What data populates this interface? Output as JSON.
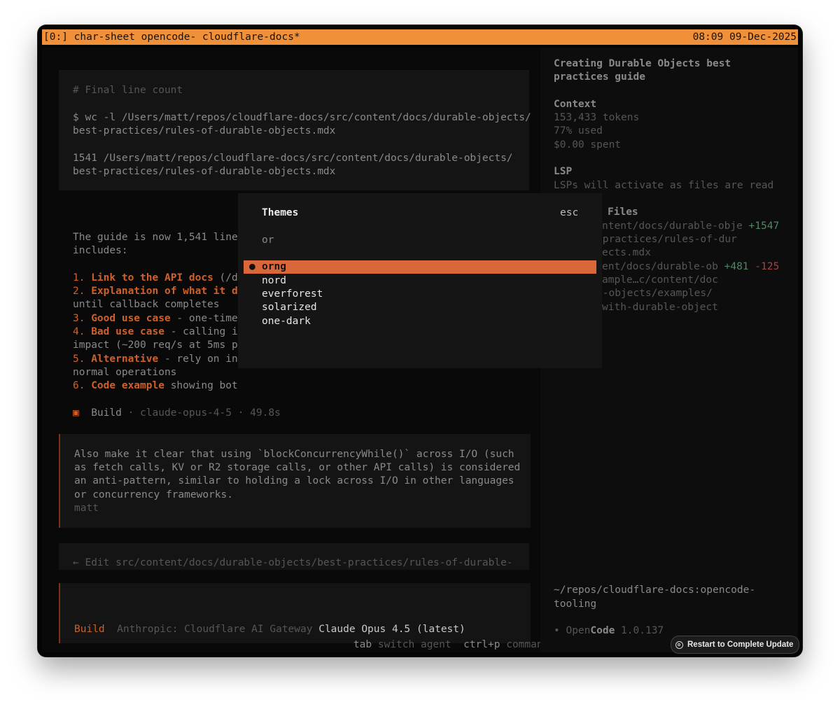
{
  "statusbar": {
    "left": "[0:] char-sheet opencode- cloudflare-docs*",
    "right": "08:09 09-Dec-2025"
  },
  "main": {
    "tool_block": {
      "comment": "# Final line count",
      "cmd1": "$ wc -l /Users/matt/repos/cloudflare-docs/src/content/docs/durable-objects/",
      "cmd2": "best-practices/rules-of-durable-objects.mdx",
      "out1": "1541 /Users/matt/repos/cloudflare-docs/src/content/docs/durable-objects/",
      "out2": "best-practices/rules-of-durable-objects.mdx"
    },
    "summary": {
      "line1": "The guide is now 1,541 line",
      "line2": "includes:",
      "items": [
        {
          "num": "1.",
          "bold": "Link to the API docs",
          "rest": " (/d"
        },
        {
          "num": "2.",
          "bold": "Explanation of what it d",
          "rest": ""
        },
        {
          "num": "",
          "bold": "",
          "rest": "until callback completes"
        },
        {
          "num": "3.",
          "bold": "Good use case",
          "rest": " - one-time"
        },
        {
          "num": "4.",
          "bold": "Bad use case",
          "rest": " - calling i"
        },
        {
          "num": "",
          "bold": "",
          "rest": "impact (~200 req/s at 5ms p"
        },
        {
          "num": "5.",
          "bold": "Alternative",
          "rest": " - rely on in"
        },
        {
          "num": "",
          "bold": "",
          "rest": "normal operations"
        },
        {
          "num": "6.",
          "bold": "Code example",
          "rest": " showing bot"
        }
      ],
      "build_icon": "▣",
      "build_label": "Build",
      "build_meta": " · claude-opus-4-5 · 49.8s"
    },
    "user_message": {
      "lines": [
        "Also make it clear that using `blockConcurrencyWhile()` across I/O (such",
        "as fetch calls, KV or R2 storage calls, or other API calls) is considered",
        "an anti-pattern, similar to holding a lock across I/O in other languages",
        "or concurrency frameworks."
      ],
      "author": "matt"
    },
    "edit_line": "← Edit src/content/docs/durable-objects/best-practices/rules-of-durable-",
    "prompt": {
      "agent": "Build",
      "provider": "Anthropic: Cloudflare AI Gateway",
      "model": "Claude Opus 4.5 (latest)"
    },
    "hints": {
      "tab_key": "tab",
      "tab_label": " switch agent",
      "cmd_key": "ctrl+p",
      "cmd_label": " commands"
    }
  },
  "sidebar": {
    "title1": "Creating Durable Objects best",
    "title2": "practices guide",
    "context_header": "Context",
    "tokens": "153,433 tokens",
    "used": "77% used",
    "spent": "$0.00 spent",
    "lsp_header": "LSP",
    "lsp_text": "LSPs will activate as files are read",
    "files_header": "Files",
    "files": [
      {
        "path": "ntent/docs/durable-obje",
        "add": "+1547",
        "del": ""
      },
      {
        "path": "-practices/rules-of-dur",
        "add": "",
        "del": ""
      },
      {
        "path": "ects.mdx",
        "add": "",
        "del": ""
      },
      {
        "path": "ent/docs/durable-ob",
        "add": "+481",
        "del": "-125"
      },
      {
        "path": "ample…c/content/doc",
        "add": "",
        "del": ""
      },
      {
        "path": "e-objects/examples/",
        "add": "",
        "del": ""
      },
      {
        "path": "with-durable-object",
        "add": "",
        "del": ""
      }
    ],
    "cwd1": "~/repos/cloudflare-docs:opencode-",
    "cwd2": "tooling",
    "version_bullet": "•",
    "version_open": "Open",
    "version_code": "Code",
    "version_num": " 1.0.137"
  },
  "dialog": {
    "title": "Themes",
    "close": "esc",
    "query": "or",
    "options": [
      "orng",
      "nord",
      "everforest",
      "solarized",
      "one-dark"
    ],
    "selected_bullet": "●"
  },
  "update_button": "Restart to Complete Update",
  "colors": {
    "statusbar": "#f0913a",
    "selection": "#d9673a",
    "accent_orange": "#d0602a",
    "diff_add": "#4a8a64",
    "diff_del": "#a34545"
  }
}
